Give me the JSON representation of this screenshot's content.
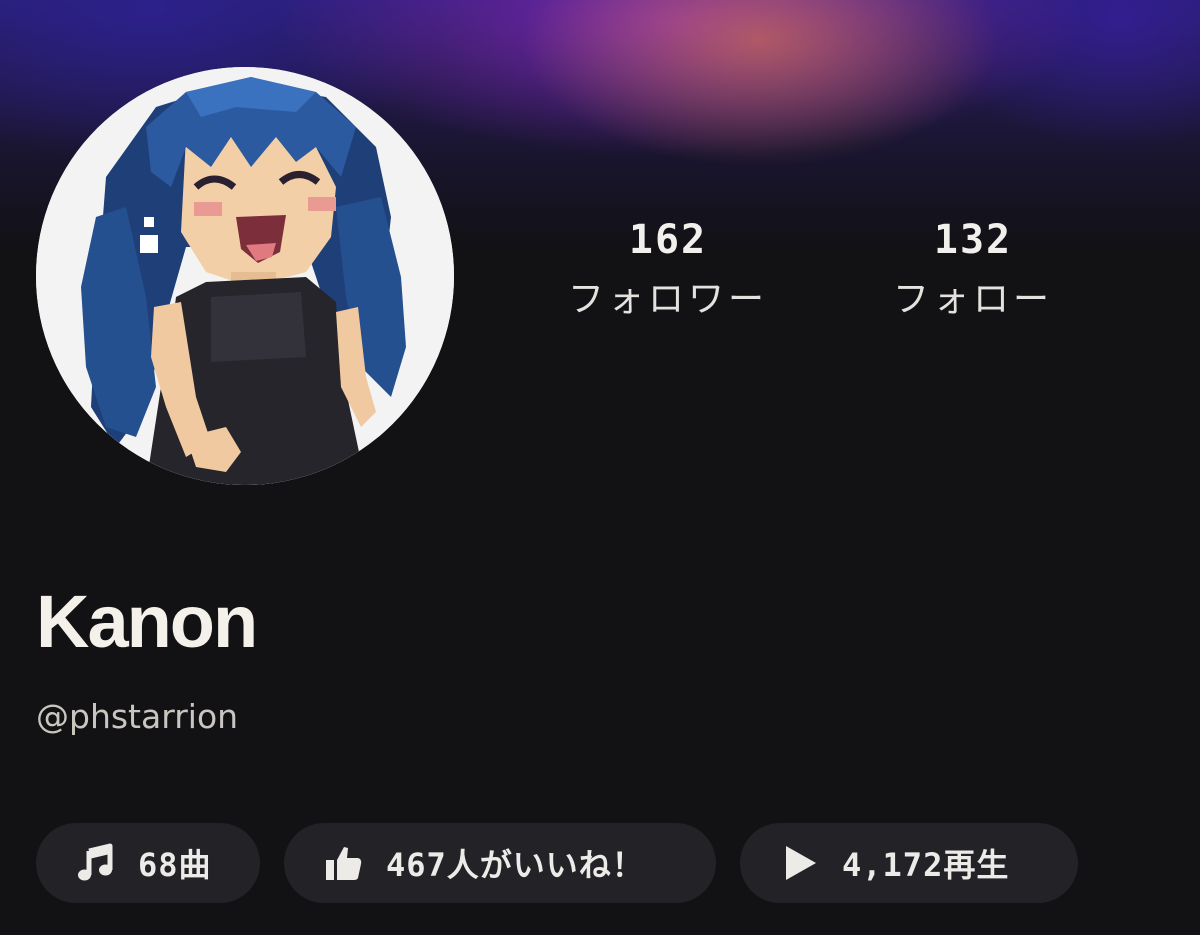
{
  "profile": {
    "display_name": "Kanon",
    "handle": "@phstarrion",
    "avatar_icon": "pixel-art-avatar"
  },
  "stats": {
    "followers": {
      "value": "162",
      "label": "フォロワー"
    },
    "following": {
      "value": "132",
      "label": "フォロー"
    }
  },
  "chips": {
    "songs": {
      "icon": "music-note-icon",
      "label": "68曲"
    },
    "likes": {
      "icon": "thumbs-up-icon",
      "label": "467人がいいね！"
    },
    "plays": {
      "icon": "play-icon",
      "label": "4,172再生"
    }
  },
  "colors": {
    "background": "#121114",
    "chip_background": "#232227",
    "text_primary": "#f4f1ea",
    "text_secondary": "#c9c6c0",
    "header_purple": "#8026b4",
    "header_orange": "#de7a48"
  }
}
